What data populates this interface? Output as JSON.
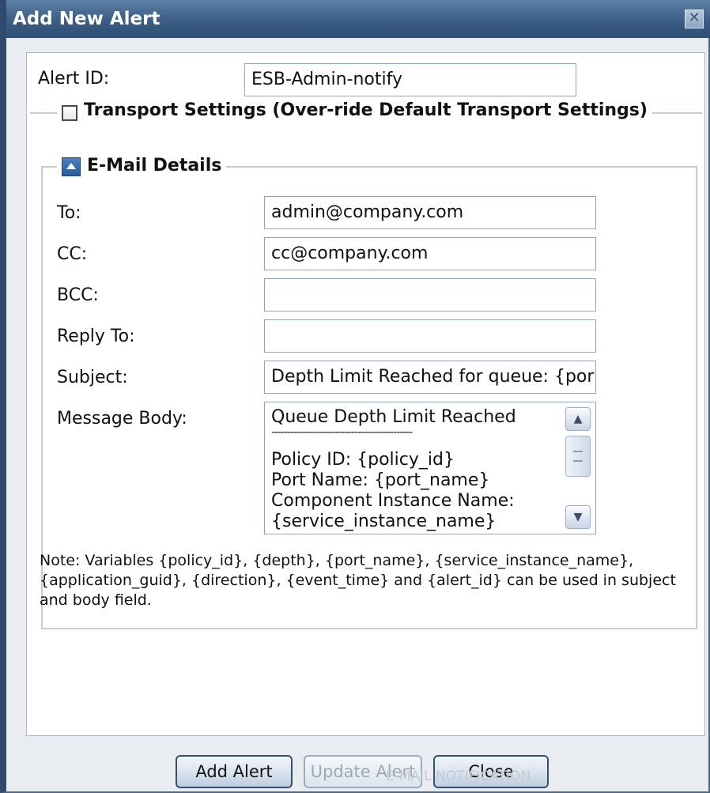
{
  "dialog": {
    "title": "Add New Alert",
    "close_glyph": "✕"
  },
  "alert_id": {
    "label": "Alert ID:",
    "value": "ESB-Admin-notify"
  },
  "transport": {
    "label": "Transport Settings (Over-ride Default Transport Settings)",
    "checked": false
  },
  "email": {
    "section_label": "E-Mail Details",
    "fields": [
      {
        "label": "To:",
        "value": "admin@company.com"
      },
      {
        "label": "CC:",
        "value": "cc@company.com"
      },
      {
        "label": "BCC:",
        "value": ""
      },
      {
        "label": "Reply To:",
        "value": ""
      },
      {
        "label": "Subject:",
        "value": "Depth Limit Reached for queue: {por"
      }
    ],
    "body": {
      "label": "Message Body:",
      "lines": [
        "Queue Depth Limit Reached",
        "--------------------------------------------",
        "Policy ID: {policy_id}",
        "Port Name: {port_name}",
        "Component Instance Name:",
        "{service_instance_name}"
      ],
      "scroll_up_glyph": "▲",
      "scroll_down_glyph": "▼"
    },
    "note": "Note: Variables {policy_id}, {depth}, {port_name}, {service_instance_name}, {application_guid}, {direction}, {event_time} and {alert_id} can be used in subject and body field."
  },
  "buttons": {
    "add": "Add Alert",
    "update": "Update Alert",
    "close": "Close"
  },
  "footer_ghost": "E-MAIL NOTIFICATION"
}
